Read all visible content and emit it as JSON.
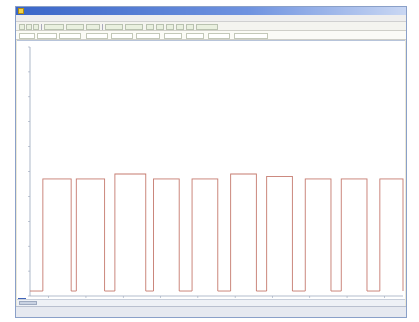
{
  "window": {
    "title": ""
  },
  "menu": {
    "items": [
      "",
      "",
      "",
      "",
      "",
      "",
      ""
    ]
  },
  "status": {
    "text": ""
  },
  "colors": {
    "trace": "#c57a6e",
    "accent": "#3f63b8"
  },
  "chart_data": {
    "type": "line",
    "x_ticks": [
      "",
      "",
      "",
      "",
      "",
      "",
      "",
      "",
      "",
      ""
    ],
    "y_ticks": [
      "",
      "",
      "",
      "",
      "",
      "",
      "",
      "",
      "",
      "",
      ""
    ],
    "series": [
      {
        "pulses": [
          {
            "start": 0.5,
            "end": 1.6,
            "high": 0.47
          },
          {
            "start": 1.8,
            "end": 2.9,
            "high": 0.47
          },
          {
            "start": 3.3,
            "end": 4.5,
            "high": 0.49
          },
          {
            "start": 4.8,
            "end": 5.8,
            "high": 0.47
          },
          {
            "start": 6.3,
            "end": 7.3,
            "high": 0.47
          },
          {
            "start": 7.8,
            "end": 8.8,
            "high": 0.49
          },
          {
            "start": 9.2,
            "end": 10.2,
            "high": 0.48
          },
          {
            "start": 10.7,
            "end": 11.7,
            "high": 0.47
          },
          {
            "start": 12.1,
            "end": 13.1,
            "high": 0.47
          },
          {
            "start": 13.6,
            "end": 14.5,
            "high": 0.47
          }
        ],
        "baseline": 0.02
      }
    ],
    "xlim": [
      0,
      14.5
    ],
    "ylim": [
      0,
      1
    ],
    "grid": false
  }
}
